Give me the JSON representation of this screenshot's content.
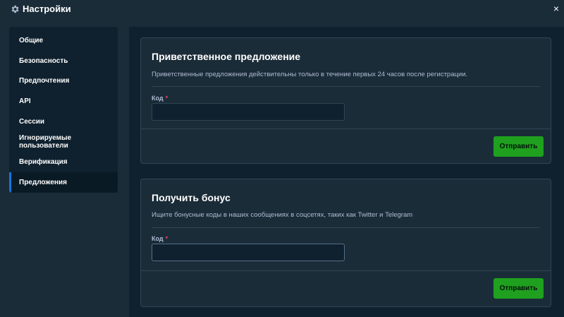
{
  "window": {
    "title": "Настройки",
    "icon": "gear-icon",
    "close_glyph": "×"
  },
  "sidebar": {
    "items": [
      {
        "label": "Общие"
      },
      {
        "label": "Безопасность"
      },
      {
        "label": "Предпочтения"
      },
      {
        "label": "API"
      },
      {
        "label": "Сессии"
      },
      {
        "label": "Игнорируемые пользователи"
      },
      {
        "label": "Верификация"
      },
      {
        "label": "Предложения",
        "active": true
      }
    ]
  },
  "offers": {
    "welcome": {
      "title": "Приветственное предложение",
      "description": "Приветственные предложения действительны только в течение первых 24 часов после регистрации.",
      "code_label": "Код",
      "required_mark": "*",
      "code_value": "",
      "submit_label": "Отправить"
    },
    "bonus": {
      "title": "Получить бонус",
      "description": "Ищите бонусные коды в наших сообщениях в соцсетях, таких как Twitter и Telegram",
      "code_label": "Код",
      "required_mark": "*",
      "code_value": "",
      "submit_label": "Отправить"
    }
  },
  "colors": {
    "background": "#1a2c38",
    "panel": "#0f212e",
    "border": "#2f4553",
    "accent_blue": "#1475e1",
    "submit_green": "#1fa01f",
    "required_red": "#ed4163"
  }
}
